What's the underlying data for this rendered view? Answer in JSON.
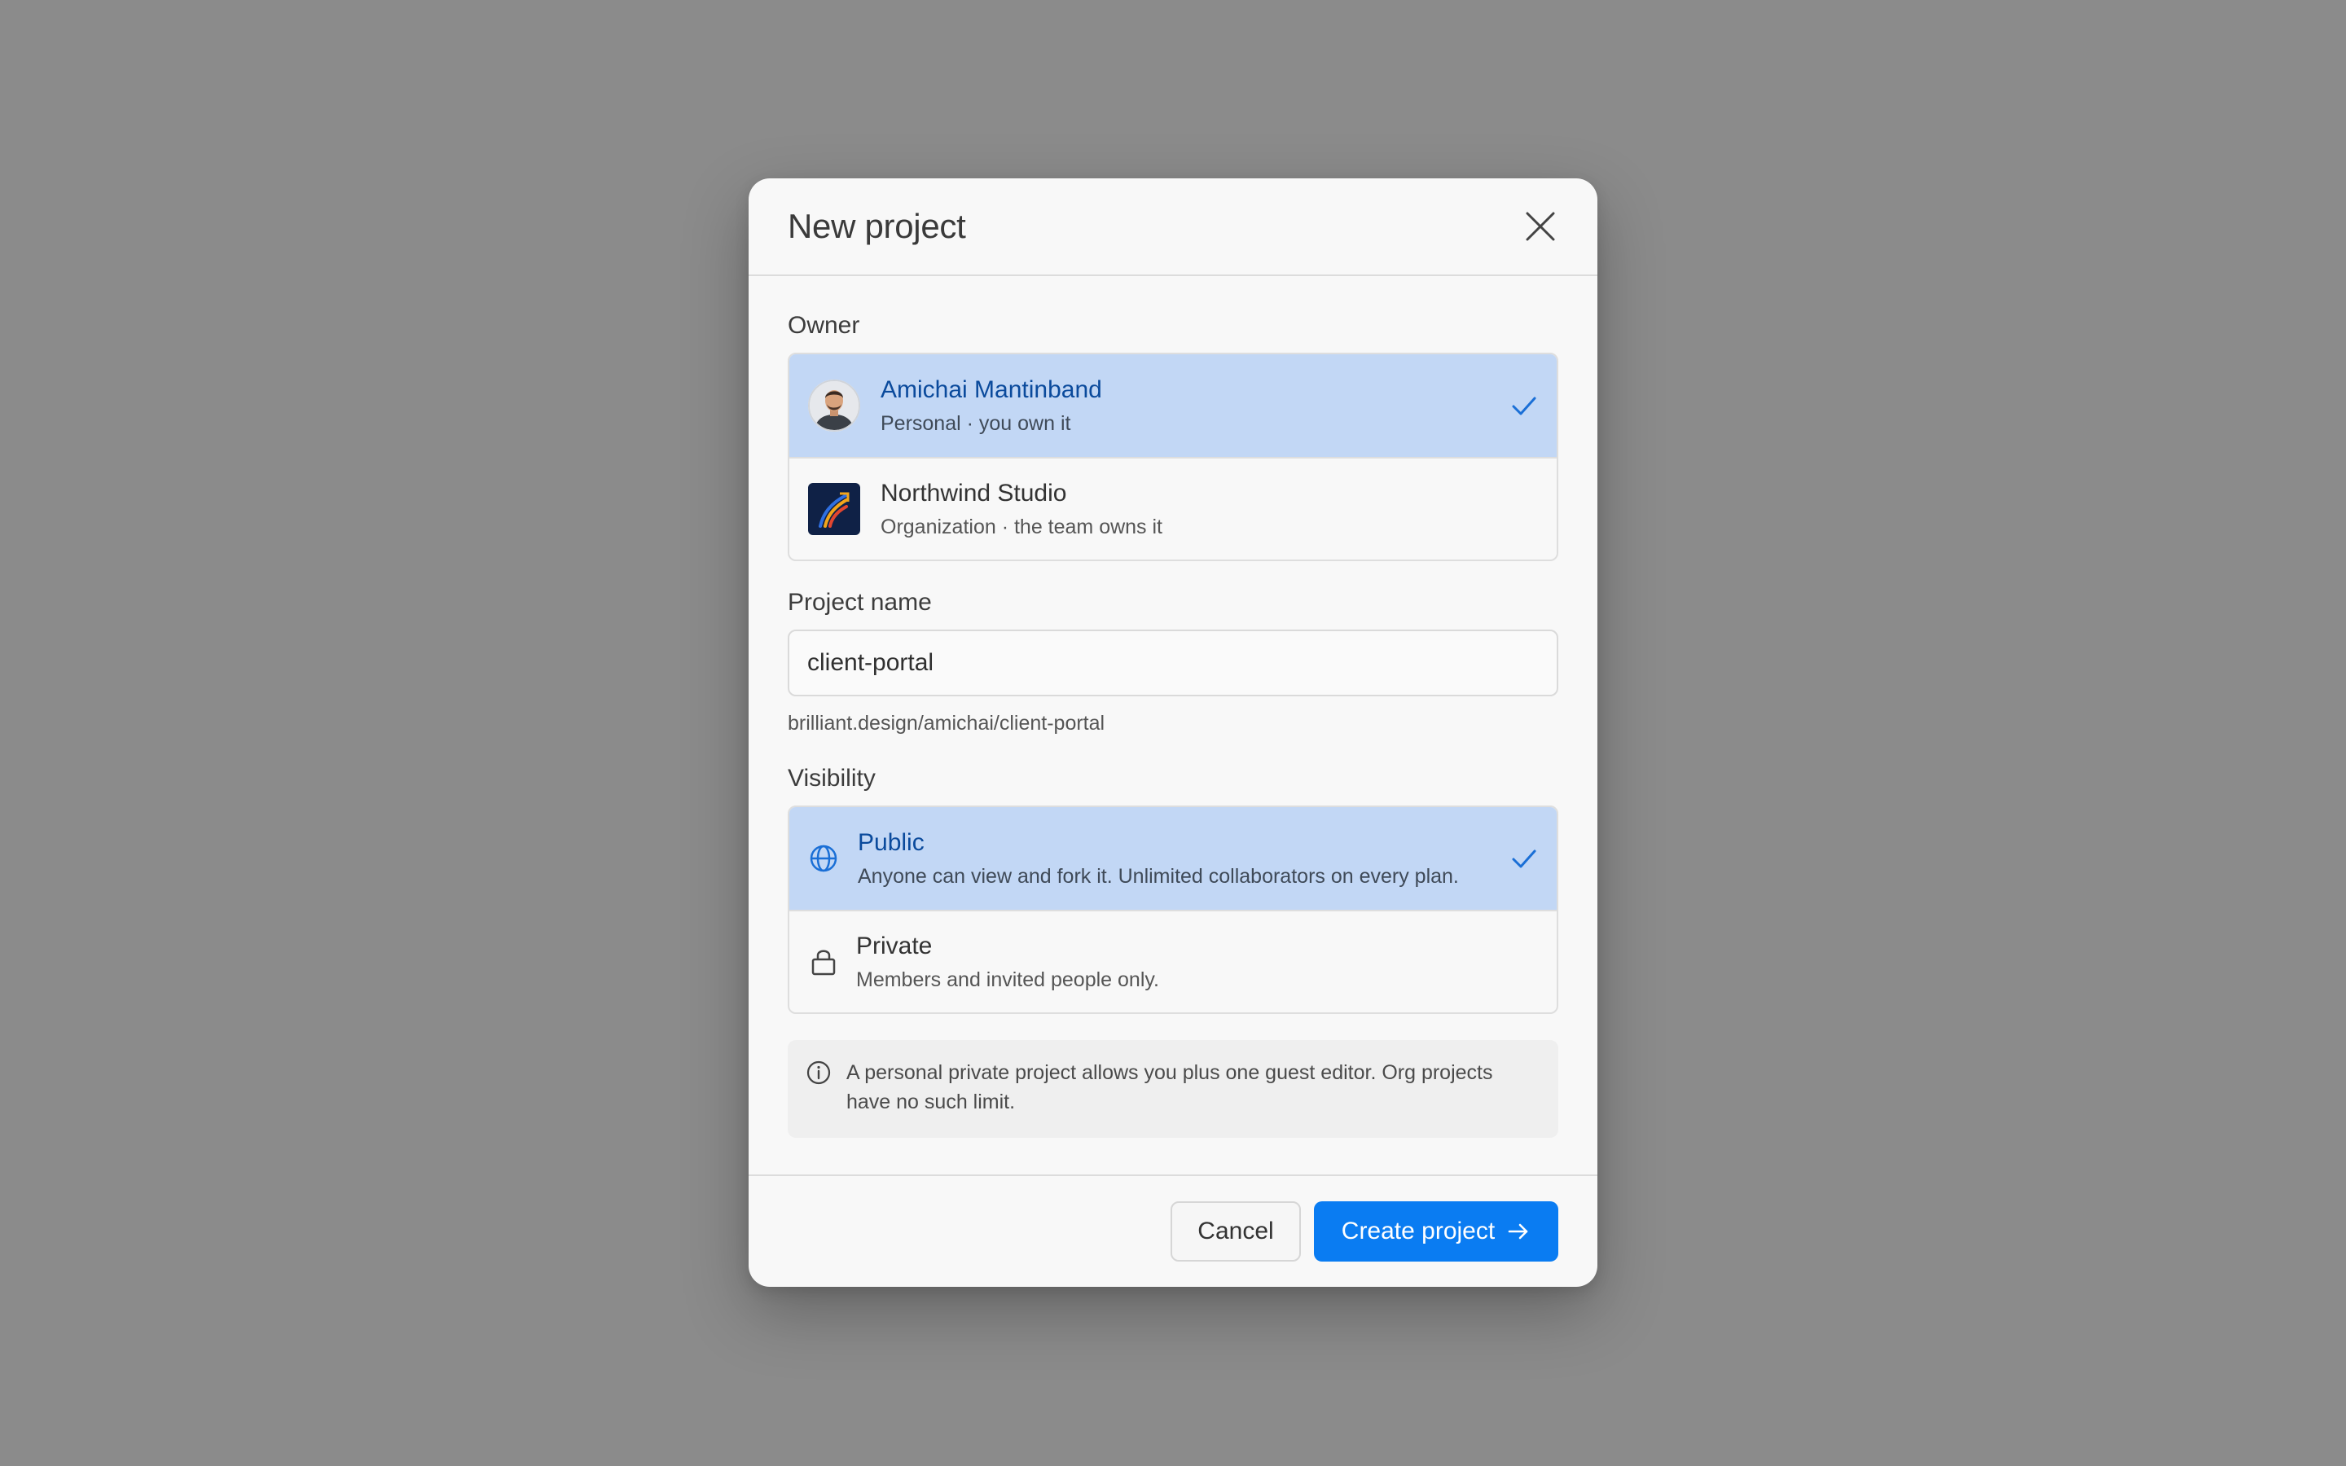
{
  "dialog": {
    "title": "New project"
  },
  "owner": {
    "label": "Owner",
    "options": [
      {
        "name": "Amichai Mantinband",
        "description": "Personal · you own it",
        "selected": true
      },
      {
        "name": "Northwind Studio",
        "description": "Organization · the team owns it",
        "selected": false
      }
    ]
  },
  "project_name": {
    "label": "Project name",
    "value": "client-portal",
    "url_preview": "brilliant.design/amichai/client-portal"
  },
  "visibility": {
    "label": "Visibility",
    "options": [
      {
        "name": "Public",
        "description": "Anyone can view and fork it. Unlimited collaborators on every plan.",
        "icon": "globe-icon",
        "selected": true
      },
      {
        "name": "Private",
        "description": "Members and invited people only.",
        "icon": "lock-icon",
        "selected": false
      }
    ]
  },
  "notice": {
    "icon": "info-icon",
    "text": "A personal private project allows you plus one guest editor. Org projects have no such limit."
  },
  "footer": {
    "cancel_label": "Cancel",
    "create_label": "Create project"
  },
  "colors": {
    "accent": "#0a7cf2",
    "selected_bg": "#c2d7f5",
    "selected_text": "#0a4a9c",
    "backdrop": "#8b8b8b"
  }
}
